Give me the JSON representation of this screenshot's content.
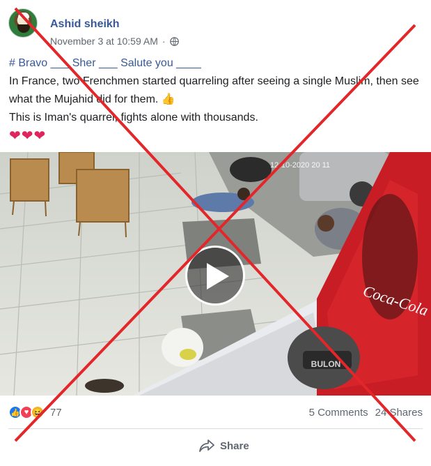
{
  "post": {
    "author": "Ashid sheikh",
    "timestamp": "November 3 at 10:59 AM",
    "privacy_icon": "globe-icon",
    "hashtag_line": "# Bravo ___ Sher ___ Salute you ____",
    "body_line1": "In France, two Frenchmen started quarreling after seeing a single Muslim, then see what the Mujahid did for them. 👍",
    "body_line2": "This is Iman's quarrel, fights alone with thousands.",
    "hearts": "❤❤❤"
  },
  "video": {
    "overlay_timestamp": "12-10-2020 20 11",
    "brand_text": "Coca-Cola",
    "helmet_text": "BULON",
    "play_icon": "play-icon"
  },
  "engagement": {
    "reaction_count": "77",
    "comments": "5 Comments",
    "shares": "24 Shares"
  },
  "actions": {
    "share_label": "Share"
  },
  "colors": {
    "link_blue": "#385898",
    "cross_red": "#e3262a",
    "muted_text": "#606770"
  }
}
